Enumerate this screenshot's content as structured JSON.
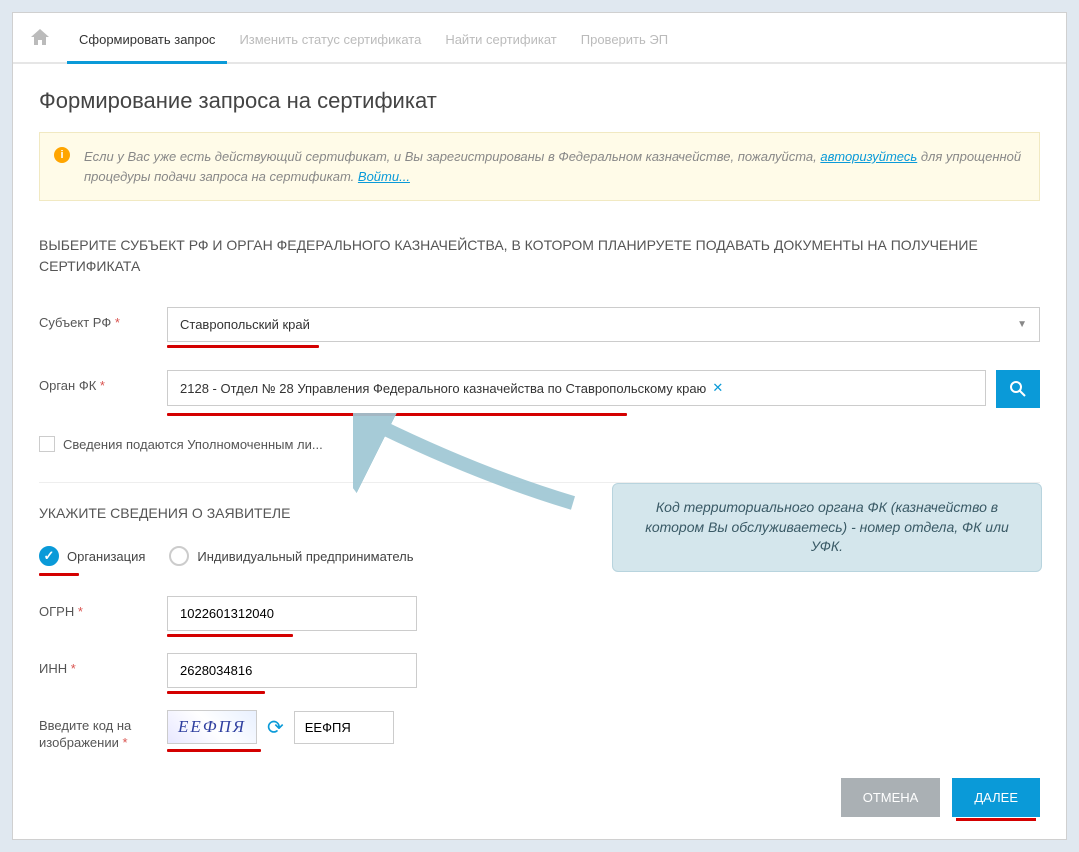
{
  "tabs": {
    "form": "Сформировать запрос",
    "change": "Изменить статус сертификата",
    "find": "Найти сертификат",
    "verify": "Проверить ЭП"
  },
  "page_title": "Формирование запроса на сертификат",
  "alert": {
    "text1": "Если у Вас уже есть действующий сертификат, и Вы зарегистрированы в Федеральном казначействе, пожалуйста, ",
    "link1": "авторизуйтесь",
    "text2": " для упрощенной процедуры подачи запроса на сертификат. ",
    "link2": "Войти..."
  },
  "section1_title": "ВЫБЕРИТЕ СУБЪЕКТ РФ И ОРГАН ФЕДЕРАЛЬНОГО КАЗНАЧЕЙСТВА, В КОТОРОМ ПЛАНИРУЕТЕ ПОДАВАТЬ ДОКУМЕНТЫ НА ПОЛУЧЕНИЕ СЕРТИФИКАТА",
  "labels": {
    "subject": "Субъект РФ",
    "organ": "Орган ФК",
    "authorized_check": "Сведения подаются Уполномоченным ли...",
    "ogrn": "ОГРН",
    "inn": "ИНН",
    "captcha": "Введите код на изображении"
  },
  "values": {
    "subject": "Ставропольский край",
    "organ": "2128 - Отдел № 28 Управления Федерального казначейства по Ставропольскому краю",
    "ogrn": "1022601312040",
    "inn": "2628034816",
    "captcha_img": "ЕЕФПЯ",
    "captcha_input": "ЕЕФПЯ"
  },
  "section2_title": "УКАЖИТЕ СВЕДЕНИЯ О ЗАЯВИТЕЛЕ",
  "radios": {
    "org": "Организация",
    "ip": "Индивидуальный предприниматель"
  },
  "buttons": {
    "cancel": "ОТМЕНА",
    "next": "ДАЛЕЕ"
  },
  "callout": "Код территориального органа ФК (казначейство в котором Вы обслуживаетесь) - номер отдела, ФК или УФК."
}
